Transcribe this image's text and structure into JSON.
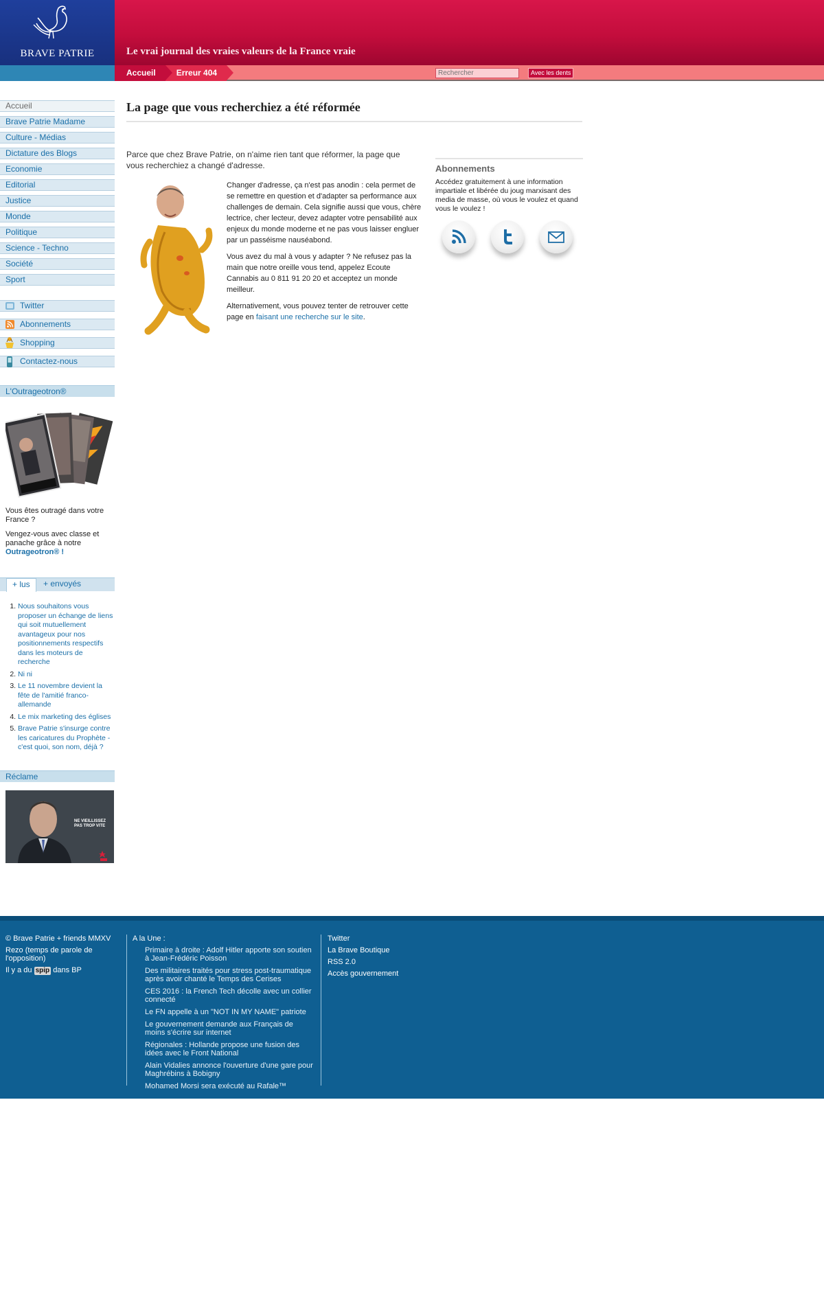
{
  "header": {
    "site_name": "BRAVE PATRIE",
    "tagline": "Le vrai journal des vraies valeurs de la France vraie",
    "breadcrumb": [
      "Accueil",
      "Erreur 404"
    ],
    "search_placeholder": "Rechercher",
    "search_button": "Avec les dents"
  },
  "sidebar": {
    "sections": [
      "Accueil",
      "Brave Patrie Madame",
      "Culture - Médias",
      "Dictature des Blogs",
      "Economie",
      "Editorial",
      "Justice",
      "Monde",
      "Politique",
      "Science - Techno",
      "Société",
      "Sport"
    ],
    "tools": [
      {
        "label": "Twitter",
        "icon": "twitter-icon"
      },
      {
        "label": "Abonnements",
        "icon": "rss-icon"
      },
      {
        "label": "Shopping",
        "icon": "shopping-icon"
      },
      {
        "label": "Contactez-nous",
        "icon": "phone-icon"
      }
    ],
    "outrage": {
      "title": "L'Outrageotron®",
      "line1": "Vous êtes outragé dans votre France ?",
      "line2": "Vengez-vous avec classe et panache grâce à notre",
      "link": "Outrageotron® !"
    },
    "tabs": [
      "+ lus",
      "+ envoyés"
    ],
    "popular": [
      "Nous souhaitons vous proposer un échange de liens qui soit mutuellement avantageux pour nos positionnements respectifs dans les moteurs de recherche",
      "Ni ni",
      "Le 11 novembre devient la fête de l'amitié franco-allemande",
      "Le mix marketing des églises",
      "Brave Patrie s'insurge contre les caricatures du Prophète - c'est quoi, son nom, déjà ?"
    ],
    "reclame": {
      "title": "Réclame",
      "ad_text": "NE VIEILLISSEZ PAS TROP VITE"
    }
  },
  "main": {
    "title": "La page que vous recherchiez a été réformée",
    "intro": "Parce que chez Brave Patrie, on n'aime rien tant que réformer, la page que vous recherchiez a changé d'adresse.",
    "para1": "Changer d'adresse, ça n'est pas anodin : cela permet de se remettre en question et d'adapter sa performance aux challenges de demain. Cela signifie aussi que vous, chère lectrice, cher lecteur, devez adapter votre pensabilité aux enjeux du monde moderne et ne pas vous laisser engluer par un passéisme nauséabond.",
    "para2": "Vous avez du mal à vous y adapter ? Ne refusez pas la main que notre oreille vous tend, appelez Ecoute Cannabis au 0 811 91 20 20 et acceptez un monde meilleur.",
    "para3_prefix": "Alternativement, vous pouvez tenter de retrouver cette page en ",
    "para3_link": "faisant une recherche sur le site",
    "para3_suffix": "."
  },
  "aside": {
    "title": "Abonnements",
    "text": "Accédez gratuitement à une information impartiale et libérée du joug marxisant des media de masse, où vous le voulez et quand vous le voulez !",
    "icons": [
      "rss-icon",
      "twitter-icon",
      "mail-icon"
    ]
  },
  "footer": {
    "col1": [
      "© Brave Patrie + friends MMXV",
      "Rezo (temps de parole de l'opposition)"
    ],
    "spip_prefix": "Il y a du",
    "spip_badge": "spip",
    "spip_suffix": "dans BP",
    "une_title": "A la Une :",
    "une": [
      "Primaire à droite : Adolf Hitler apporte son soutien à Jean-Frédéric Poisson",
      "Des militaires traités pour stress post-traumatique après avoir chanté le Temps des Cerises",
      "CES 2016 : la French Tech décolle avec un collier connecté",
      "Le FN appelle à un \"NOT IN MY NAME\" patriote",
      "Le gouvernement demande aux Français de moins s'écrire sur internet",
      "Régionales : Hollande propose une fusion des idées avec le Front National",
      "Alain Vidalies annonce l'ouverture d'une gare pour Maghrébins à Bobigny",
      "Mohamed Morsi sera exécuté au Rafale™"
    ],
    "col3": [
      "Twitter",
      "La Brave Boutique",
      "RSS 2.0",
      "Accès gouvernement"
    ]
  },
  "colors": {
    "brand_blue": "#18307e",
    "banner_red": "#c30d3c",
    "link_blue": "#1a6fa8",
    "footer_blue": "#0f5f92"
  }
}
